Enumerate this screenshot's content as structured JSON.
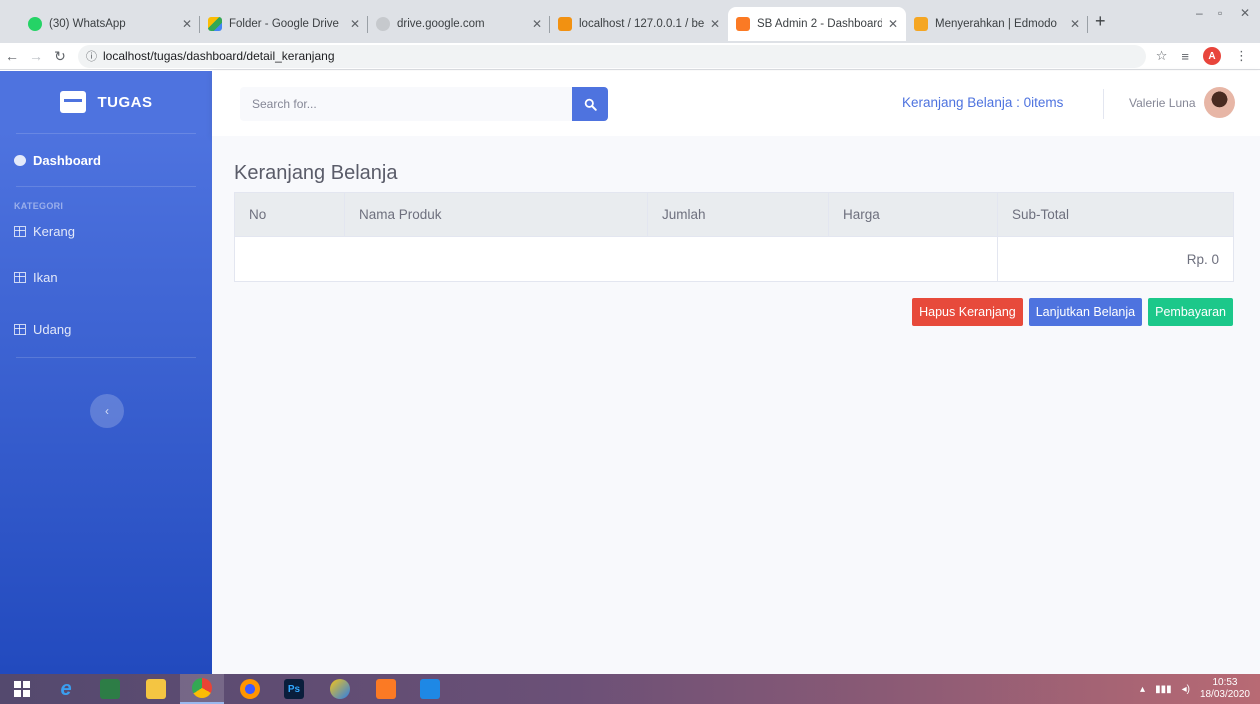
{
  "browser": {
    "tabs": [
      {
        "title": "(30) WhatsApp",
        "icon": "whatsapp-icon",
        "color": "#25d366"
      },
      {
        "title": "Folder - Google Drive",
        "icon": "drive-icon",
        "color": "#fbbc04"
      },
      {
        "title": "drive.google.com",
        "icon": "globe-icon",
        "color": "#9aa0a6"
      },
      {
        "title": "localhost / 127.0.0.1 / be",
        "icon": "phpmyadmin-icon",
        "color": "#f29111"
      },
      {
        "title": "SB Admin 2 - Dashboard",
        "icon": "xampp-icon",
        "color": "#fb7a24"
      },
      {
        "title": "Menyerahkan | Edmodo",
        "icon": "edmodo-icon",
        "color": "#f5a623"
      }
    ],
    "url": "localhost/tugas/dashboard/detail_keranjang",
    "profile_initial": "A"
  },
  "sidebar": {
    "brand": "TUGAS",
    "dashboard": "Dashboard",
    "heading": "KATEGORI",
    "items": [
      {
        "label": "Kerang"
      },
      {
        "label": "Ikan"
      },
      {
        "label": "Udang"
      }
    ]
  },
  "topbar": {
    "search_placeholder": "Search for...",
    "cart_text": "Keranjang Belanja : 0items",
    "user_name": "Valerie Luna"
  },
  "main": {
    "title": "Keranjang Belanja",
    "columns": [
      "No",
      "Nama Produk",
      "Jumlah",
      "Harga",
      "Sub-Total"
    ],
    "total": "Rp. 0",
    "buttons": {
      "clear": "Hapus Keranjang",
      "continue": "Lanjutkan Belanja",
      "pay": "Pembayaran"
    }
  },
  "taskbar": {
    "time": "10:53",
    "date": "18/03/2020"
  },
  "colors": {
    "primary": "#4e73df",
    "danger": "#e74a3b",
    "success": "#1cc88a"
  }
}
